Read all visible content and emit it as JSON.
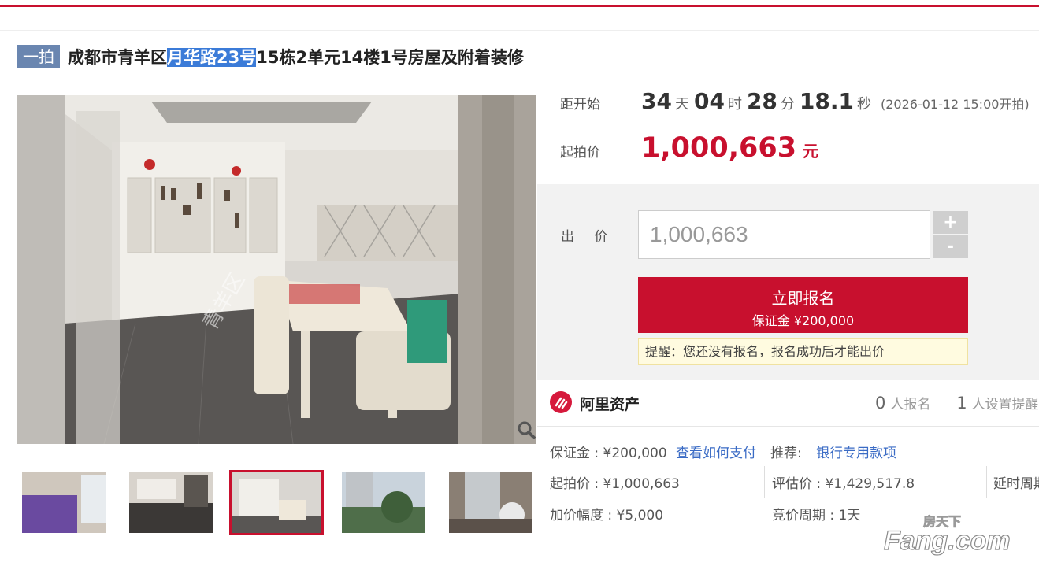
{
  "header": {
    "badge": "一拍",
    "title_pre": "成都市青羊区",
    "title_highlight": "月华路23号",
    "title_post": "15栋2单元14楼1号房屋及附着装修"
  },
  "countdown": {
    "label": "距开始",
    "days": "34",
    "days_unit": "天",
    "hours": "04",
    "hours_unit": "时",
    "minutes": "28",
    "minutes_unit": "分",
    "seconds": "18.1",
    "seconds_unit": "秒",
    "start_time": "(2026-01-12 15:00开拍)"
  },
  "starting_price": {
    "label": "起拍价",
    "value": "1,000,663",
    "unit": "元"
  },
  "bid": {
    "label": "出 价",
    "input_value": "1,000,663",
    "plus": "+",
    "minus": "-",
    "signup_label": "立即报名",
    "deposit_label": "保证金 ¥200,000",
    "notice": "提醒：您还没有报名，报名成功后才能出价"
  },
  "platform": {
    "name": "阿里资产",
    "signup_count": "0",
    "signup_label": "人报名",
    "reminder_count": "1",
    "reminder_label": "人设置提醒"
  },
  "details": {
    "deposit": "保证金 : ¥200,000",
    "how_to_pay": "查看如何支付",
    "recommend_label": "推荐:",
    "recommend_link": "银行专用款项",
    "start_price": "起拍价 : ¥1,000,663",
    "appraisal": "评估价 : ¥1,429,517.8",
    "delay": "延时周期",
    "increment": "加价幅度 : ¥5,000",
    "cycle": "竞价周期 : 1天"
  },
  "image_watermark": "青羊区",
  "watermark": {
    "top": "房天下",
    "bottom": "Fang.com"
  },
  "colors": {
    "accent": "#c8102e",
    "badge": "#6a86b0",
    "link": "#3a6bc5"
  },
  "icons": [
    "zoom-icon",
    "ali-logo-icon"
  ]
}
